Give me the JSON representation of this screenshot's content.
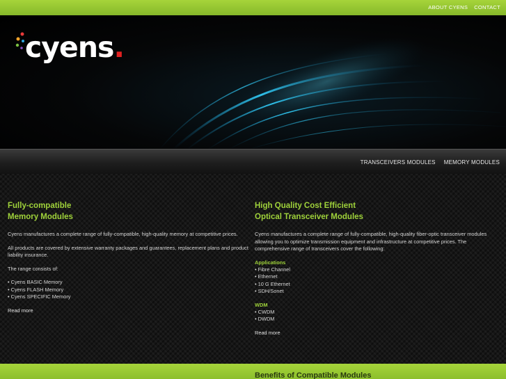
{
  "colors": {
    "accent_green": "#9fd23a",
    "logo_red": "#e02020",
    "glow_cyan": "#2ec8ff"
  },
  "topnav": {
    "items": [
      "ABOUT CYENS",
      "CONTACT"
    ]
  },
  "logo": {
    "text": "cyens",
    "period": "."
  },
  "mainnav": {
    "items": [
      "TRANSCEIVERS MODULES",
      "MEMORY MODULES"
    ]
  },
  "left": {
    "title_line1": "Fully-compatible",
    "title_line2": "Memory Modules",
    "para1": "Cyens manufactures a complete range of fully-compatible, high-quality memory at competitive prices.",
    "para2": "All products are covered by extensive warranty packages and guarantees, replacement plans and product liability insurance.",
    "para3": "The range consists of:",
    "list": [
      "• Cyens BASIC Memory",
      "• Cyens FLASH Memory",
      "• Cyens SPECIFIC Memory"
    ],
    "read_more": "Read more"
  },
  "right": {
    "title_line1": "High Quality Cost Efficient",
    "title_line2": "Optical Transceiver Modules",
    "para1": "Cyens manufactures a complete range of fully-compatible, high-quality fiber-optic transceiver modules allowing you to optimize transmission equipment and infrastructure at competitive prices. The comprehensive range of transceivers cover the following:",
    "applications_heading": "Applications",
    "applications": [
      "• Fibre Channel",
      "• Ethernet",
      "• 10 G Ethernet",
      "• SDH/Sonet"
    ],
    "wdm_heading": "WDM",
    "wdm": [
      "• CWDM",
      "• DWDM"
    ],
    "read_more": "Read more"
  },
  "bottom": {
    "heading": "Benefits of Compatible Modules"
  }
}
